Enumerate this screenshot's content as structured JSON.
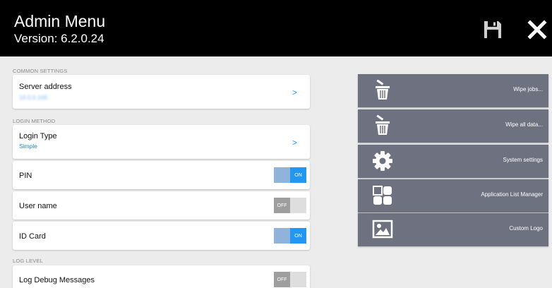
{
  "header": {
    "title": "Admin Menu",
    "version": "Version: 6.2.0.24"
  },
  "sections": {
    "common": "COMMON SETTINGS",
    "login": "LOGIN METHOD",
    "log": "LOG LEVEL"
  },
  "server_address": {
    "label": "Server address",
    "value": "10.0.0.100",
    "chevron": ">"
  },
  "login_type": {
    "label": "Login Type",
    "value": "Simple",
    "chevron": ">"
  },
  "toggles": {
    "pin": {
      "label": "PIN",
      "state": "ON"
    },
    "user_name": {
      "label": "User name",
      "state": "OFF"
    },
    "id_card": {
      "label": "ID Card",
      "state": "ON"
    },
    "log_debug": {
      "label": "Log Debug Messages",
      "state": "OFF"
    }
  },
  "actions": {
    "wipe_jobs": "Wipe jobs...",
    "wipe_all": "Wipe all data...",
    "system_settings": "System settings",
    "app_list": "Application List Manager",
    "custom_logo": "Custom Logo"
  },
  "colors": {
    "header": "#000000",
    "accent": "#2196f3",
    "action_bg": "#6e7180",
    "background": "#ececec"
  },
  "icons": [
    "save-icon",
    "close-icon",
    "trash-icon",
    "gear-icon",
    "apps-grid-icon",
    "image-icon"
  ]
}
